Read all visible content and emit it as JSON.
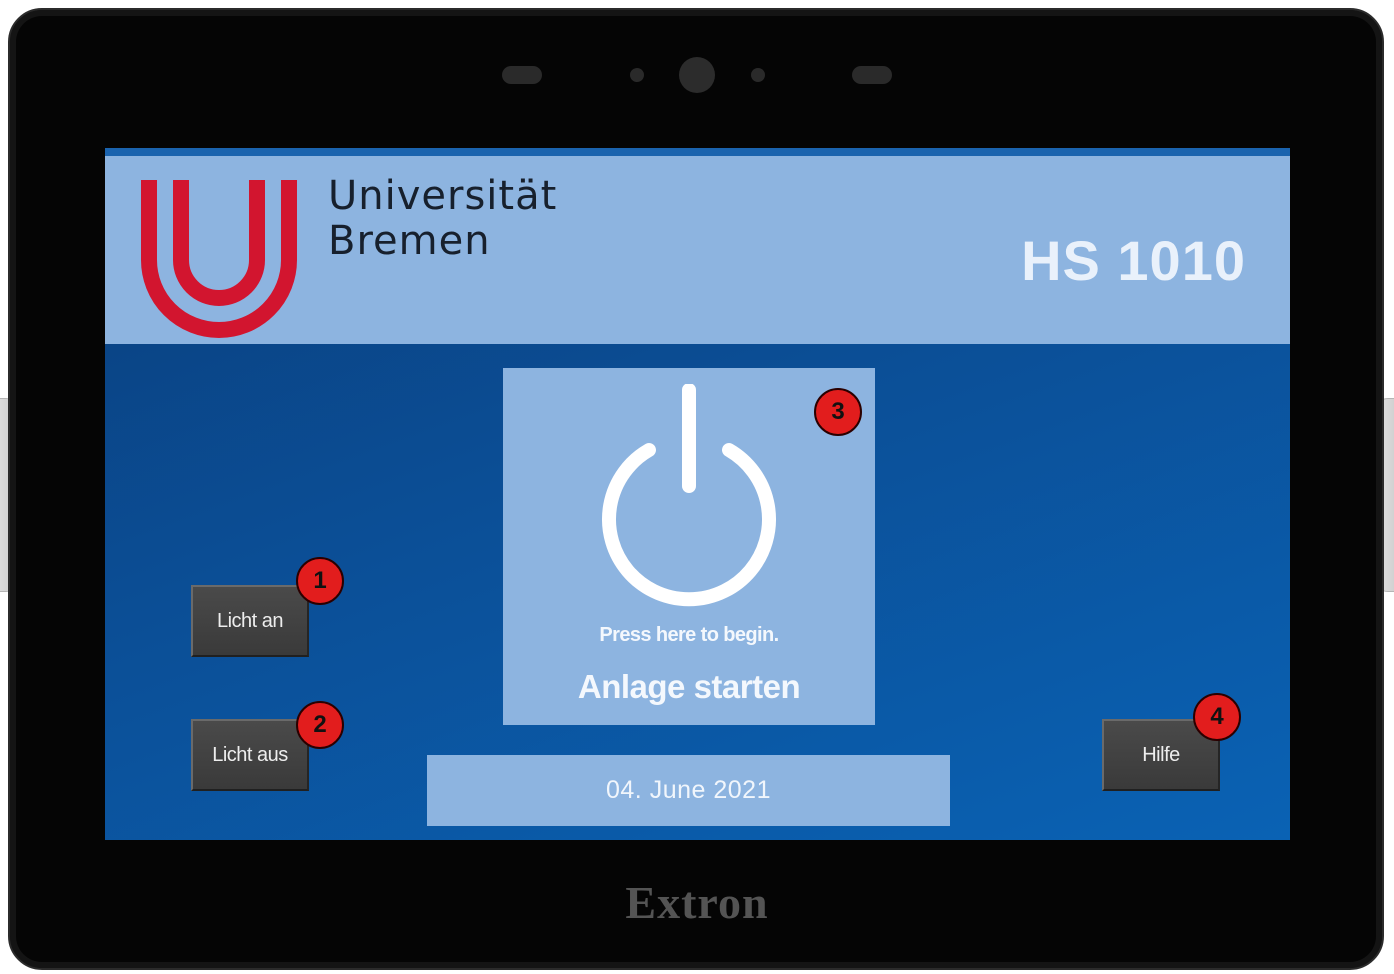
{
  "header": {
    "university_line1": "Universität",
    "university_line2": "Bremen",
    "room": "HS 1010"
  },
  "buttons": {
    "light_on": "Licht an",
    "light_off": "Licht aus",
    "help": "Hilfe"
  },
  "start_panel": {
    "icon": "power-icon",
    "hint": "Press here to begin.",
    "label": "Anlage starten"
  },
  "date": "04. June 2021",
  "device_brand": "Extron",
  "markers": [
    "1",
    "2",
    "3",
    "4"
  ],
  "colors": {
    "header_background": "#8db4e0",
    "screen_background": "#0b4f97",
    "logo_red": "#d2152f",
    "button_background": "#404040",
    "marker_red": "#e21d1d"
  }
}
